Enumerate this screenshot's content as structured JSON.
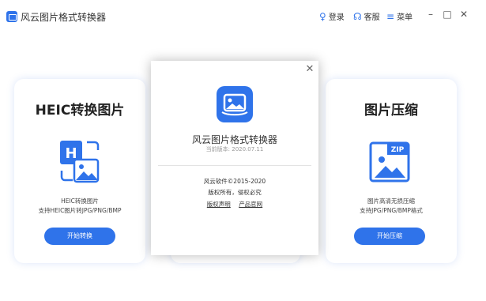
{
  "titlebar": {
    "title": "风云图片格式转换器",
    "login": "登录",
    "service": "客服",
    "menu": "菜单"
  },
  "cards": {
    "heic": {
      "title": "HEIC转换图片",
      "desc1": "HEIC转换图片",
      "desc2": "支持HEIC图片转JPG/PNG/BMP",
      "button": "开始转换"
    },
    "compress": {
      "title": "图片压缩",
      "desc1": "图片高清无损压缩",
      "desc2": "支持JPG/PNG/BMP格式",
      "button": "开始压缩"
    }
  },
  "dialog": {
    "app_name": "风云图片格式转换器",
    "version": "当前版本: 2020.07.11",
    "copyright": "风云软件©2015-2020",
    "rights": "版权所有，侵权必究",
    "link_copyright": "版权声明",
    "link_website": "产品官网"
  },
  "colors": {
    "accent": "#2f73ea",
    "background": "#ffffff"
  }
}
